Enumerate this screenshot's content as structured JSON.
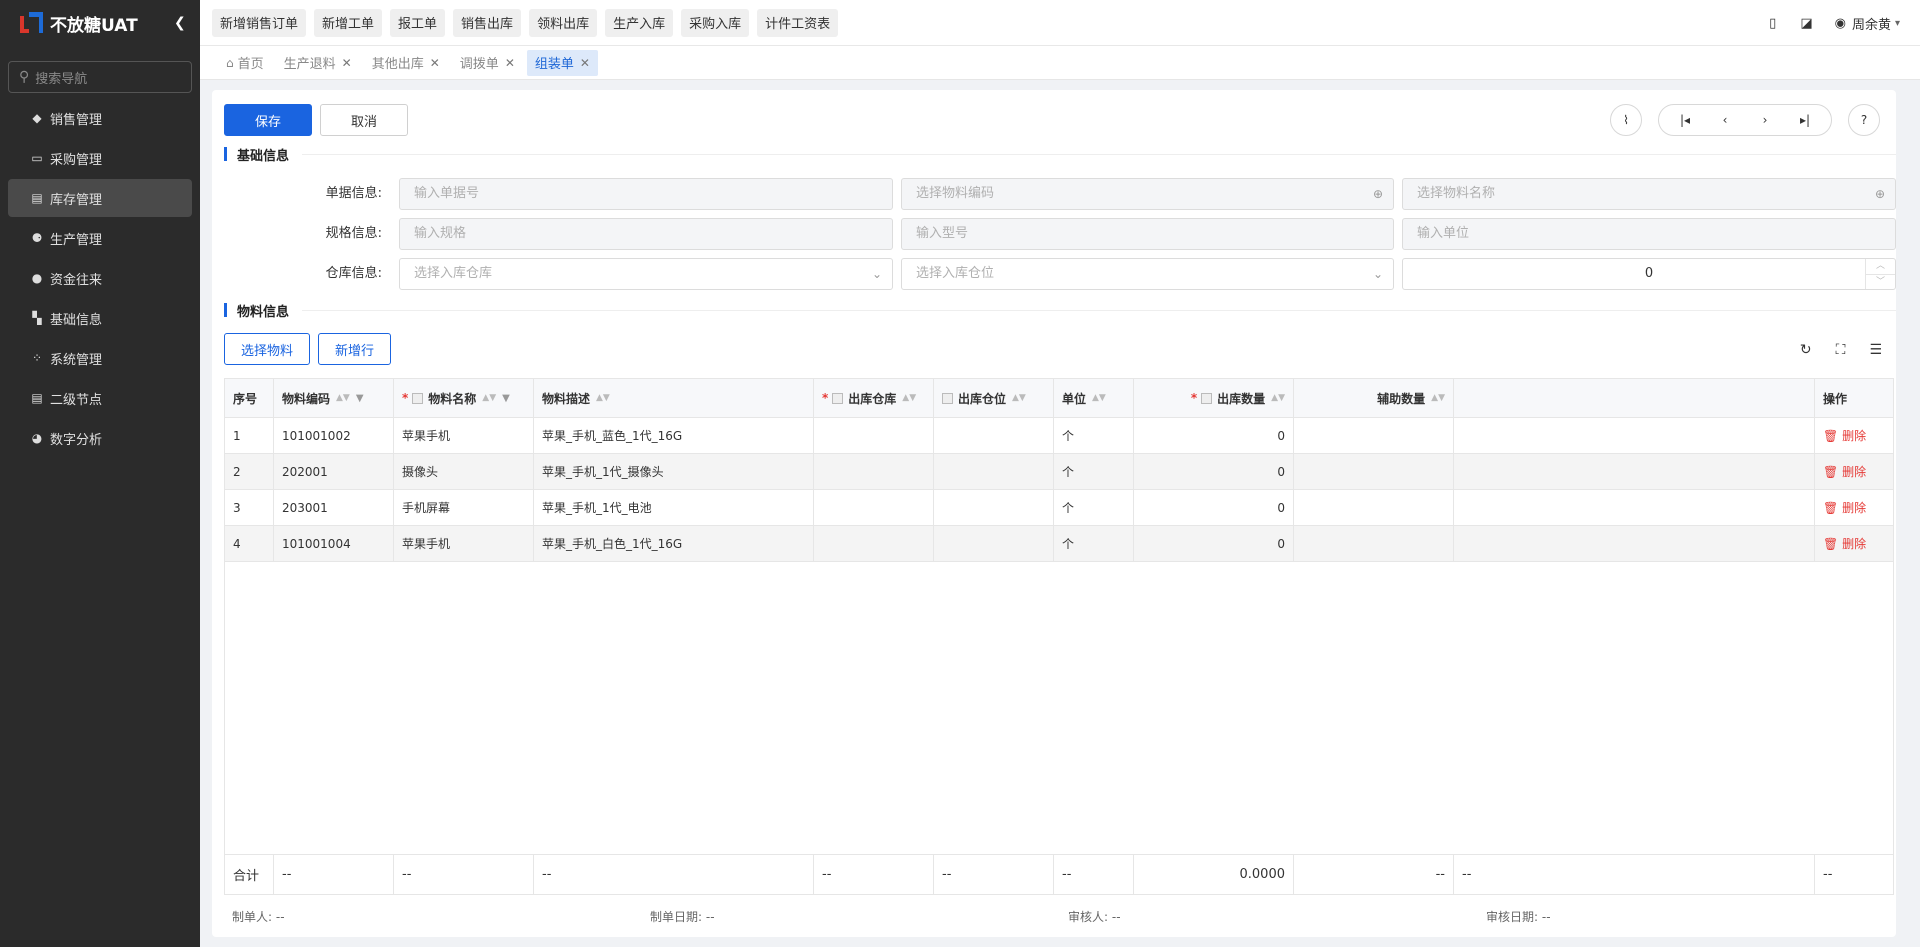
{
  "app": {
    "title": "不放糖UAT"
  },
  "sidebar": {
    "search_placeholder": "搜索导航",
    "items": [
      {
        "label": "销售管理",
        "icon": "tag-icon"
      },
      {
        "label": "采购管理",
        "icon": "cart-icon"
      },
      {
        "label": "库存管理",
        "icon": "warehouse-icon"
      },
      {
        "label": "生产管理",
        "icon": "factory-icon"
      },
      {
        "label": "资金往来",
        "icon": "money-icon"
      },
      {
        "label": "基础信息",
        "icon": "grid-icon"
      },
      {
        "label": "系统管理",
        "icon": "apps-icon"
      },
      {
        "label": "二级节点",
        "icon": "list-icon"
      },
      {
        "label": "数字分析",
        "icon": "pie-chart-icon"
      }
    ]
  },
  "quick_links": [
    "新增销售订单",
    "新增工单",
    "报工单",
    "销售出库",
    "领料出库",
    "生产入库",
    "采购入库",
    "计件工资表"
  ],
  "header": {
    "user_name": "周余黄"
  },
  "tabs": [
    {
      "label": "首页"
    },
    {
      "label": "生产退料"
    },
    {
      "label": "其他出库"
    },
    {
      "label": "调拨单"
    },
    {
      "label": "组装单"
    }
  ],
  "toolbar": {
    "save_label": "保存",
    "cancel_label": "取消"
  },
  "sections": {
    "basic": "基础信息",
    "material": "物料信息"
  },
  "form": {
    "doc_label": "单据信息:",
    "spec_label": "规格信息:",
    "wh_label": "仓库信息:",
    "doc_no_placeholder": "输入单据号",
    "material_code_placeholder": "选择物料编码",
    "material_name_placeholder": "选择物料名称",
    "spec_placeholder": "输入规格",
    "model_placeholder": "输入型号",
    "unit_placeholder": "输入单位",
    "warehouse_placeholder": "选择入库仓库",
    "location_placeholder": "选择入库仓位",
    "quantity_value": "0"
  },
  "table_buttons": {
    "select_material": "选择物料",
    "add_row": "新增行"
  },
  "table": {
    "columns": [
      "序号",
      "物料编码",
      "物料名称",
      "物料描述",
      "出库仓库",
      "出库仓位",
      "单位",
      "出库数量",
      "辅助数量",
      "",
      "操作"
    ],
    "rows": [
      {
        "no": "1",
        "code": "101001002",
        "name": "苹果手机",
        "desc": "苹果_手机_蓝色_1代_16G",
        "wh": "",
        "loc": "",
        "unit": "个",
        "qty": "0",
        "aux": "",
        "op": "删除"
      },
      {
        "no": "2",
        "code": "202001",
        "name": "摄像头",
        "desc": "苹果_手机_1代_摄像头",
        "wh": "",
        "loc": "",
        "unit": "个",
        "qty": "0",
        "aux": "",
        "op": "删除"
      },
      {
        "no": "3",
        "code": "203001",
        "name": "手机屏幕",
        "desc": "苹果_手机_1代_电池",
        "wh": "",
        "loc": "",
        "unit": "个",
        "qty": "0",
        "aux": "",
        "op": "删除"
      },
      {
        "no": "4",
        "code": "101001004",
        "name": "苹果手机",
        "desc": "苹果_手机_白色_1代_16G",
        "wh": "",
        "loc": "",
        "unit": "个",
        "qty": "0",
        "aux": "",
        "op": "删除"
      }
    ],
    "total": {
      "label": "合计",
      "dash": "--",
      "qty": "0.0000"
    }
  },
  "footer": {
    "creator_label": "制单人:",
    "creator_value": "--",
    "create_date_label": "制单日期:",
    "create_date_value": "--",
    "auditor_label": "审核人:",
    "auditor_value": "--",
    "audit_date_label": "审核日期:",
    "audit_date_value": "--"
  }
}
